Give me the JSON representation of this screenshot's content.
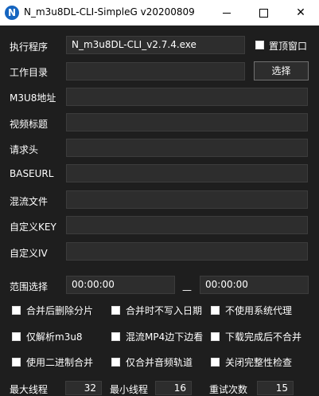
{
  "window": {
    "title": "N_m3u8DL-CLI-SimpleG v20200809",
    "app_icon_letter": "N",
    "minimize_icon": "minimize-icon",
    "maximize_icon": "maximize-icon",
    "close_icon": "close-icon",
    "close_glyph": "✕"
  },
  "form": {
    "exe_label": "执行程序",
    "exe_value": "N_m3u8DL-CLI_v2.7.4.exe",
    "topmost_label": "置顶窗口",
    "workdir_label": "工作目录",
    "workdir_value": "",
    "browse_label": "选择",
    "m3u8_label": "M3U8地址",
    "m3u8_value": "",
    "video_title_label": "视频标题",
    "video_title_value": "",
    "headers_label": "请求头",
    "headers_value": "",
    "baseurl_label": "BASEURL",
    "baseurl_value": "",
    "mux_file_label": "混流文件",
    "mux_file_value": "",
    "key_label": "自定义KEY",
    "key_value": "",
    "iv_label": "自定义IV",
    "iv_value": ""
  },
  "range": {
    "label": "范围选择",
    "start": "00:00:00",
    "separator": "—",
    "end": "00:00:00"
  },
  "options": [
    {
      "label": "合并后删除分片",
      "checked": false
    },
    {
      "label": "合并时不写入日期",
      "checked": false
    },
    {
      "label": "不使用系统代理",
      "checked": false
    },
    {
      "label": "仅解析m3u8",
      "checked": false
    },
    {
      "label": "混流MP4边下边看",
      "checked": false
    },
    {
      "label": "下载完成后不合并",
      "checked": false
    },
    {
      "label": "使用二进制合并",
      "checked": false
    },
    {
      "label": "仅合并音频轨道",
      "checked": false
    },
    {
      "label": "关闭完整性检查",
      "checked": false
    }
  ],
  "threads": {
    "max_label": "最大线程",
    "max_value": "32",
    "min_label": "最小线程",
    "min_value": "16",
    "retry_label": "重试次数",
    "retry_value": "15"
  }
}
